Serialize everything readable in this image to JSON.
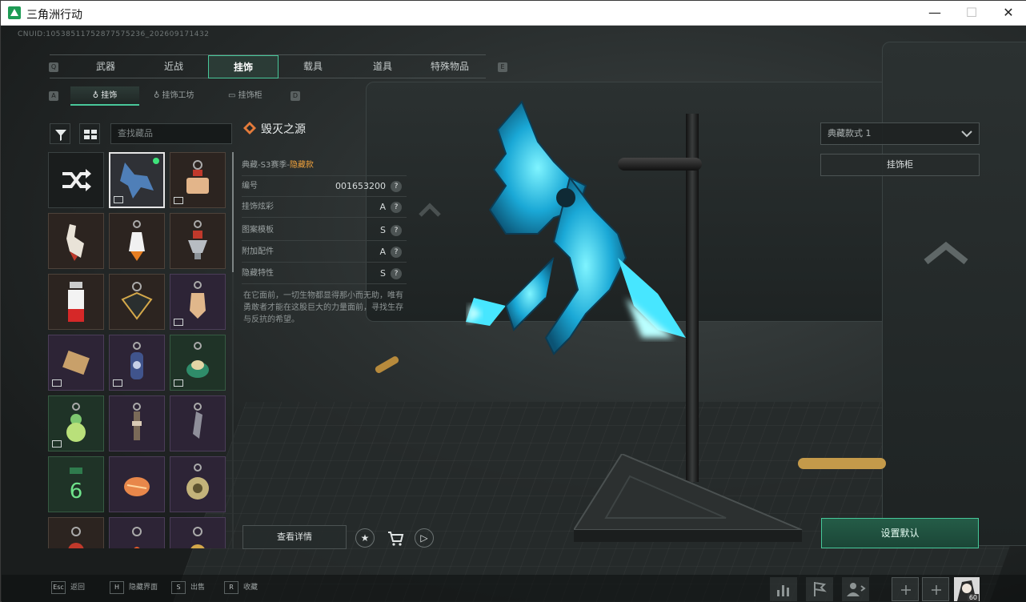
{
  "window": {
    "title": "三角洲行动",
    "minimize": "—",
    "maximize": "☐",
    "close": "✕"
  },
  "cnuid": "CNUID:10538511752877575236_202609171432",
  "tabs": {
    "left_key": "Q",
    "right_key": "E",
    "items": [
      {
        "label": "武器"
      },
      {
        "label": "近战"
      },
      {
        "label": "挂饰",
        "active": true
      },
      {
        "label": "载具"
      },
      {
        "label": "道具"
      },
      {
        "label": "特殊物品"
      }
    ]
  },
  "subtabs": {
    "left_key": "A",
    "right_key": "D",
    "items": [
      {
        "label": "挂饰",
        "active": true
      },
      {
        "label": "挂饰工坊"
      },
      {
        "label": "挂饰柜"
      }
    ]
  },
  "search": {
    "placeholder": "查找藏品"
  },
  "grid": {
    "rows": [
      [
        {
          "kind": "shuffle",
          "icon": "shuffle-icon"
        },
        {
          "kind": "blue",
          "selected": true,
          "badge": true,
          "equipped": true,
          "icon": "blue-dragon-charm-icon"
        },
        {
          "kind": "brown",
          "badge": true,
          "icon": "treasure-chest-charm-icon"
        }
      ],
      [
        {
          "kind": "brown",
          "icon": "rooster-charm-icon"
        },
        {
          "kind": "brown",
          "icon": "rocket-charm-icon"
        },
        {
          "kind": "brown",
          "icon": "cup-charm-icon"
        }
      ],
      [
        {
          "kind": "brown",
          "icon": "canister-charm-icon"
        },
        {
          "kind": "brown",
          "icon": "emblem-charm-icon"
        },
        {
          "kind": "violet",
          "badge": true,
          "icon": "hand-charm-icon"
        }
      ],
      [
        {
          "kind": "violet",
          "badge": true,
          "icon": "card-charm-icon"
        },
        {
          "kind": "violet",
          "badge": true,
          "icon": "capsule-charm-icon"
        },
        {
          "kind": "green",
          "badge": true,
          "icon": "snail-charm-icon"
        }
      ],
      [
        {
          "kind": "green",
          "badge": true,
          "icon": "gourd-charm-icon"
        },
        {
          "kind": "violet",
          "icon": "dagger-charm-icon"
        },
        {
          "kind": "violet",
          "icon": "blade-charm-icon"
        }
      ],
      [
        {
          "kind": "green",
          "icon": "number-six-charm-icon"
        },
        {
          "kind": "violet",
          "icon": "fish-charm-icon"
        },
        {
          "kind": "violet",
          "icon": "disc-charm-icon"
        }
      ],
      [
        {
          "kind": "brown",
          "icon": "red-charm-icon"
        },
        {
          "kind": "violet",
          "icon": "flame-charm-icon"
        },
        {
          "kind": "violet",
          "icon": "orb-charm-icon"
        }
      ]
    ]
  },
  "detail": {
    "name": "毁灭之源",
    "season_prefix": "典藏-S3赛季-",
    "season_highlight": "隐藏款",
    "rows": [
      {
        "label": "编号",
        "value": "001653200"
      },
      {
        "label": "挂饰炫彩",
        "value": "A"
      },
      {
        "label": "图案模板",
        "value": "S"
      },
      {
        "label": "附加配件",
        "value": "A"
      },
      {
        "label": "隐藏特性",
        "value": "S"
      }
    ],
    "help": "?",
    "description": "在它面前，一切生物都显得那小而无助，唯有勇敢者才能在这股巨大的力量面前，寻找生存与反抗的希望。"
  },
  "actions": {
    "view_details": "查看详情",
    "favorite": "★",
    "shop": "🛒",
    "play": "▷"
  },
  "right_panel": {
    "style_select": "典藏款式 1",
    "cabinet_button": "挂饰柜",
    "set_default": "设置默认"
  },
  "hotkeys": [
    {
      "key": "Esc",
      "label": "返回"
    },
    {
      "key": "H",
      "label": "隐藏界面"
    },
    {
      "key": "S",
      "label": "出售"
    },
    {
      "key": "R",
      "label": "收藏"
    }
  ],
  "avatar_level": "60",
  "colors": {
    "accent": "#48c79a",
    "highlight_text": "#f0a23c",
    "equipped_dot": "#3ee37b"
  }
}
